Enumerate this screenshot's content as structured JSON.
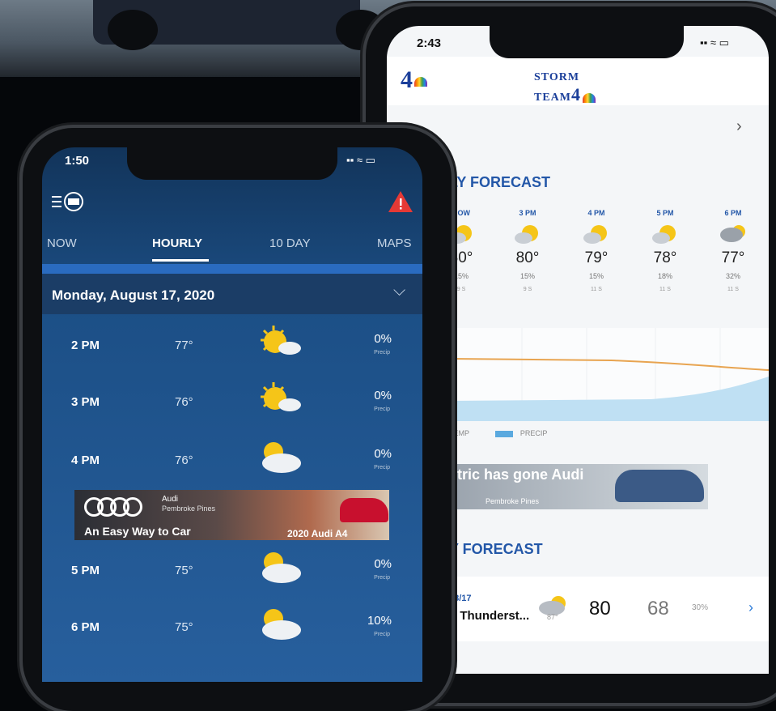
{
  "back_phone": {
    "time": "2:43",
    "status": "▪▪ ≈ ▭",
    "logo_left": "4",
    "logo_storm": "STORM",
    "logo_team": "TEAM",
    "logo_num": "4",
    "hourly_title": "LY FORECAST",
    "hours": [
      {
        "label": "NOW",
        "temp": "80°",
        "precip": "15%",
        "wind": "9 S"
      },
      {
        "label": "3 PM",
        "temp": "80°",
        "precip": "15%",
        "wind": "9 S"
      },
      {
        "label": "4 PM",
        "temp": "79°",
        "precip": "15%",
        "wind": "11 S"
      },
      {
        "label": "5 PM",
        "temp": "78°",
        "precip": "18%",
        "wind": "11 S"
      },
      {
        "label": "6 PM",
        "temp": "77°",
        "precip": "32%",
        "wind": "11 S"
      }
    ],
    "legend_temp": "TEMP",
    "legend_precip": "PRECIP",
    "ad_text": "tric has gone Audi",
    "ad_sub": "Pembroke Pines",
    "daily_title": "Y FORECAST",
    "daily": {
      "date": "08/17",
      "condition": "l Thunderst...",
      "hi": "80",
      "lo": "68",
      "precip": "30%",
      "small_temp": "87°"
    }
  },
  "front_phone": {
    "time": "1:50",
    "status": "▪▪ ≈ ▭",
    "tabs": [
      {
        "label": "NOW",
        "active": false
      },
      {
        "label": "HOURLY",
        "active": true
      },
      {
        "label": "10 DAY",
        "active": false
      },
      {
        "label": "MAPS",
        "active": false
      }
    ],
    "date": "Monday, August 17, 2020",
    "rows": [
      {
        "time": "2 PM",
        "temp": "77°",
        "pct": "0%",
        "sub": "Precip",
        "icon": "sunny-cloud-icon"
      },
      {
        "time": "3 PM",
        "temp": "76°",
        "pct": "0%",
        "sub": "Precip",
        "icon": "sunny-cloud-icon"
      },
      {
        "time": "4 PM",
        "temp": "76°",
        "pct": "0%",
        "sub": "Precip",
        "icon": "partly-cloudy-icon"
      },
      {
        "time": "5 PM",
        "temp": "75°",
        "pct": "0%",
        "sub": "Precip",
        "icon": "partly-cloudy-icon"
      },
      {
        "time": "6 PM",
        "temp": "75°",
        "pct": "10%",
        "sub": "Precip",
        "icon": "partly-cloudy-icon"
      }
    ],
    "ad": {
      "brand": "Audi",
      "location": "Pembroke Pines",
      "tagline": "An Easy Way to Car",
      "model": "2020 Audi A4"
    }
  },
  "colors": {
    "accent_blue": "#2357a8",
    "alert_red": "#e53935",
    "sun_yellow": "#f5c518"
  }
}
